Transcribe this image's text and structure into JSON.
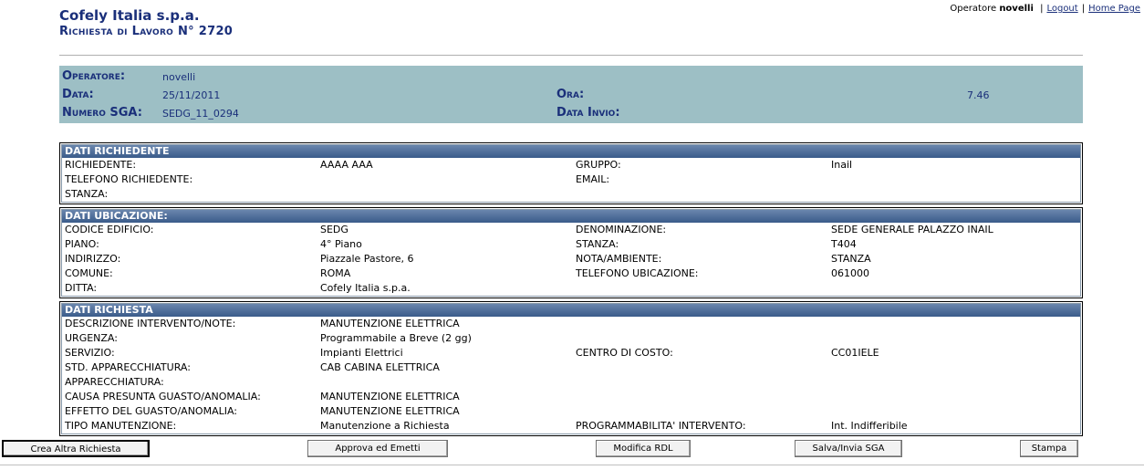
{
  "header": {
    "company": "Cofely Italia s.p.a.",
    "title": "Richiesta di Lavoro N° 2720",
    "operator_prefix": "Operatore",
    "operator_name": "novelli",
    "logout": "Logout",
    "home": "Home Page"
  },
  "summary": {
    "operatore_label": "Operatore:",
    "operatore_value": "novelli",
    "data_label": "Data:",
    "data_value": "25/11/2011",
    "ora_label": "Ora:",
    "ora_value": "7.46",
    "numero_label": "Numero SGA:",
    "numero_value": "SEDG_11_0294",
    "data_invio_label": "Data Invio:"
  },
  "richiedente": {
    "title": "DATI RICHIEDENTE",
    "rows": [
      [
        "RICHIEDENTE:",
        "AAAA AAA",
        "GRUPPO:",
        "Inail"
      ],
      [
        "TELEFONO RICHIEDENTE:",
        "",
        "EMAIL:",
        ""
      ],
      [
        "STANZA:",
        "",
        "",
        ""
      ]
    ]
  },
  "ubicazione": {
    "title": "DATI UBICAZIONE:",
    "rows": [
      [
        "CODICE EDIFICIO:",
        "SEDG",
        "DENOMINAZIONE:",
        "SEDE GENERALE PALAZZO INAIL"
      ],
      [
        "PIANO:",
        "4° Piano",
        "STANZA:",
        "T404"
      ],
      [
        "INDIRIZZO:",
        "Piazzale Pastore, 6",
        "NOTA/AMBIENTE:",
        "STANZA"
      ],
      [
        "COMUNE:",
        "ROMA",
        "TELEFONO UBICAZIONE:",
        "061000"
      ],
      [
        "DITTA:",
        "Cofely Italia s.p.a.",
        "",
        ""
      ]
    ]
  },
  "richiesta": {
    "title": "DATI RICHIESTA",
    "rows": [
      [
        "DESCRIZIONE INTERVENTO/NOTE:",
        "MANUTENZIONE ELETTRICA",
        "",
        ""
      ],
      [
        "URGENZA:",
        "Programmabile a Breve (2 gg)",
        "",
        ""
      ],
      [
        "SERVIZIO:",
        "Impianti Elettrici",
        "CENTRO DI COSTO:",
        "CC01IELE"
      ],
      [
        "STD. APPARECCHIATURA:",
        "CAB CABINA ELETTRICA",
        "",
        ""
      ],
      [
        "APPARECCHIATURA:",
        "",
        "",
        ""
      ],
      [
        "CAUSA PRESUNTA GUASTO/ANOMALIA:",
        "MANUTENZIONE ELETTRICA",
        "",
        ""
      ],
      [
        "EFFETTO DEL GUASTO/ANOMALIA:",
        "MANUTENZIONE ELETTRICA",
        "",
        ""
      ],
      [
        "TIPO MANUTENZIONE:",
        "Manutenzione a Richiesta",
        "PROGRAMMABILITA' INTERVENTO:",
        "Int. Indifferibile"
      ]
    ]
  },
  "buttons": {
    "crea": "Crea Altra Richiesta",
    "approva": "Approva ed Emetti",
    "modifica": "Modifica RDL",
    "salva": "Salva/Invia SGA",
    "stampa": "Stampa"
  }
}
